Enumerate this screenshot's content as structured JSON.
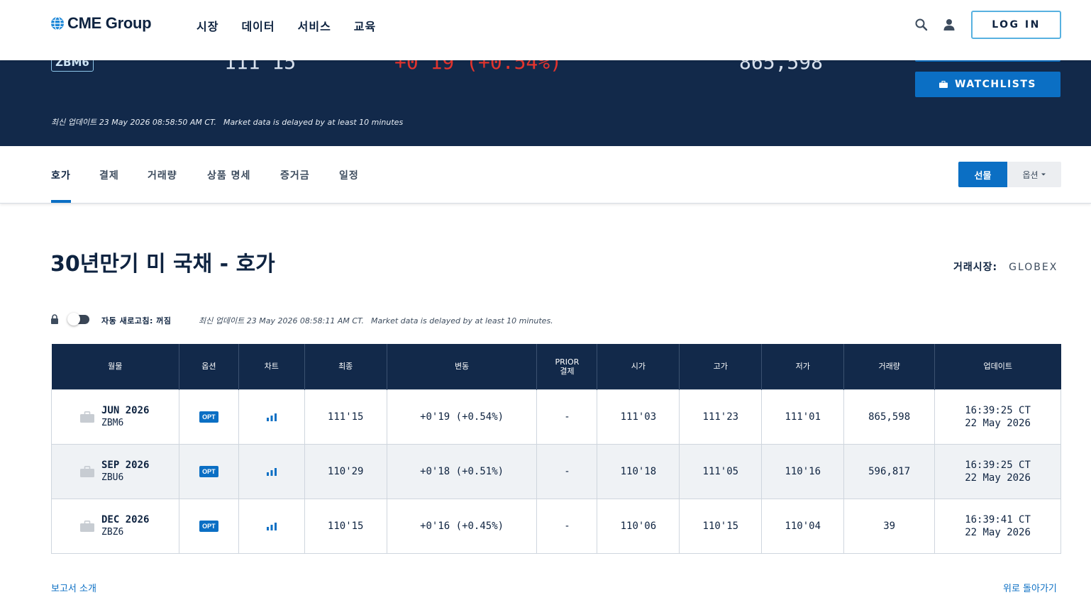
{
  "nav": {
    "logo_text": "CME Group",
    "items": [
      "시장",
      "데이터",
      "서비스",
      "교육"
    ],
    "login_label": "LOG IN"
  },
  "banner": {
    "code": "ZBM6",
    "last": "111'15",
    "change": "+0'19 (+0.54%)",
    "volume": "865,598",
    "watchlists_label": "WATCHLISTS",
    "update_time": "최신 업데이트 23 May 2026 08:58:50 AM CT.",
    "delay_note": "Market data is delayed by at least 10 minutes"
  },
  "tabs": {
    "items": [
      "호가",
      "결제",
      "거래량",
      "상품 명세",
      "증거금",
      "일정"
    ],
    "futures_label": "선물",
    "options_label": "옵션",
    "accent": "#0b6fc4"
  },
  "page": {
    "title": "30년만기 미 국채 - 호가",
    "exchange_label": "거래시장:",
    "exchange_value": "GLOBEX"
  },
  "refresh": {
    "label": "자동 새로고침: 꺼짐",
    "update_time": "최신 업데이트 23 May 2026 08:58:11 AM CT.",
    "delay_note": "Market data is delayed by at least 10 minutes."
  },
  "table": {
    "headers": {
      "month": "월물",
      "options": "옵션",
      "chart": "차트",
      "last": "최종",
      "change": "변동",
      "prior_1": "PRIOR",
      "prior_2": "결제",
      "open": "시가",
      "high": "고가",
      "low": "저가",
      "volume": "거래량",
      "updated": "업데이트"
    },
    "opt_label": "OPT",
    "rows": [
      {
        "month": "JUN 2026",
        "code": "ZBM6",
        "last": "111'15",
        "change": "+0'19 (+0.54%)",
        "prior": "-",
        "open": "111'03",
        "high": "111'23",
        "low": "111'01",
        "volume": "865,598",
        "time": "16:39:25 CT",
        "date": "22 May 2026"
      },
      {
        "month": "SEP 2026",
        "code": "ZBU6",
        "last": "110'29",
        "change": "+0'18 (+0.51%)",
        "prior": "-",
        "open": "110'18",
        "high": "111'05",
        "low": "110'16",
        "volume": "596,817",
        "time": "16:39:25 CT",
        "date": "22 May 2026"
      },
      {
        "month": "DEC 2026",
        "code": "ZBZ6",
        "last": "110'15",
        "change": "+0'16 (+0.45%)",
        "prior": "-",
        "open": "110'06",
        "high": "110'15",
        "low": "110'04",
        "volume": "39",
        "time": "16:39:41 CT",
        "date": "22 May 2026"
      }
    ]
  },
  "footer": {
    "report_link": "보고서 소개",
    "back_to_top": "위로 돌아가기"
  },
  "colors": {
    "navy": "#12294a",
    "positive": "#1c8a2a",
    "negative": "#e2342e"
  }
}
